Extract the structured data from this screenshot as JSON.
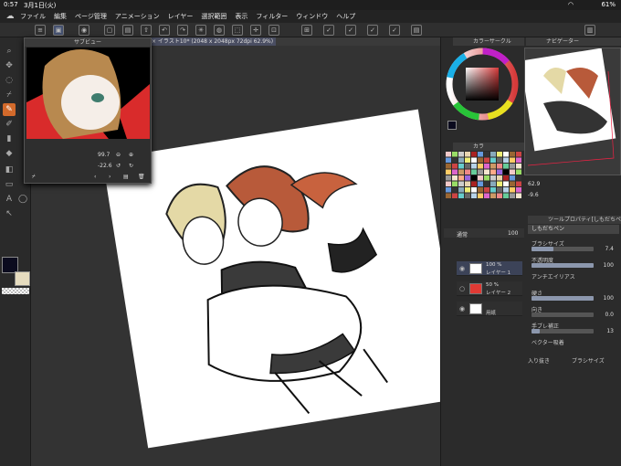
{
  "status": {
    "time": "0:57",
    "date": "3月1日(火)",
    "battery": "61%"
  },
  "menu": [
    "ファイル",
    "編集",
    "ページ管理",
    "アニメーション",
    "レイヤー",
    "選択範囲",
    "表示",
    "フィルター",
    "ウィンドウ",
    "ヘルプ"
  ],
  "canvas": {
    "tab_label": "× イラスト10* (2048 x 2048px 72dpi 62.9%)"
  },
  "subview": {
    "title": "サブビュー",
    "zoom": "99.7",
    "angle": "-22.6"
  },
  "color_circle": {
    "title": "カラーサークル",
    "hue_accent": "#d63a3a"
  },
  "navigator": {
    "title": "ナビゲーター",
    "zoom": "62.9",
    "angle": "-9.6"
  },
  "color_set": {
    "title": "カラ"
  },
  "layers": {
    "blend": "通常",
    "opacity": "100",
    "items": [
      {
        "pct": "100 %",
        "name": "レイヤー 1",
        "thumb": "#ffffff"
      },
      {
        "pct": "50 %",
        "name": "レイヤー 2",
        "thumb": "#e03a34"
      },
      {
        "pct": "",
        "name": "用紙",
        "thumb": "#ffffff"
      }
    ]
  },
  "tool_property": {
    "title": "ツールプロパティ[しもだちペン]",
    "brush_name": "しもだちペン",
    "rows": [
      {
        "label": "ブラシサイズ",
        "value": "7.4",
        "fill": 0.35
      },
      {
        "label": "不透明度",
        "value": "100",
        "fill": 1.0
      },
      {
        "label": "アンチエイリアス",
        "value": "",
        "fill": 0
      },
      {
        "label": "硬さ",
        "value": "100",
        "fill": 1.0
      },
      {
        "label": "向き",
        "value": "0.0",
        "fill": 0.0
      },
      {
        "label": "手ブレ補正",
        "value": "13",
        "fill": 0.13
      },
      {
        "label": "ベクター吸着",
        "value": "",
        "fill": 0
      }
    ],
    "inout": "入り抜き",
    "inout_value": "ブラシサイズ"
  }
}
